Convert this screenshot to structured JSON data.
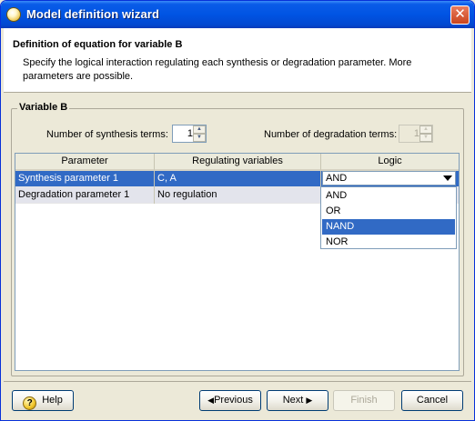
{
  "window": {
    "title": "Model definition wizard",
    "close_symbol": "✕"
  },
  "header": {
    "title": "Definition of equation for variable B",
    "description": "Specify the logical interaction regulating each synthesis or degradation parameter. More parameters are possible."
  },
  "group": {
    "label": "Variable B",
    "synthesis_label": "Number of synthesis terms:",
    "synthesis_value": "1",
    "degradation_label": "Number of degradation terms:",
    "degradation_value": "1"
  },
  "table": {
    "columns": [
      "Parameter",
      "Regulating variables",
      "Logic"
    ],
    "rows": [
      {
        "parameter": "Synthesis parameter 1",
        "regulating": "C, A",
        "logic": "AND"
      },
      {
        "parameter": "Degradation parameter 1",
        "regulating": "No regulation",
        "logic": ""
      }
    ]
  },
  "logic_dropdown": {
    "selected": "AND",
    "options": [
      "AND",
      "OR",
      "NAND",
      "NOR"
    ],
    "highlighted": "NAND"
  },
  "buttons": {
    "help": "Help",
    "previous": "Previous",
    "next": "Next",
    "finish": "Finish",
    "cancel": "Cancel"
  },
  "icons": {
    "title": "app-icon",
    "close": "close-icon",
    "help": "help-icon",
    "previous": "left-triangle-icon",
    "next": "right-triangle-icon",
    "combo": "chevron-down-icon",
    "spin_up": "spin-up-icon",
    "spin_down": "spin-down-icon"
  },
  "colors": {
    "titlebar": "#0054e3",
    "selection": "#316ac5",
    "close": "#c9441d"
  }
}
